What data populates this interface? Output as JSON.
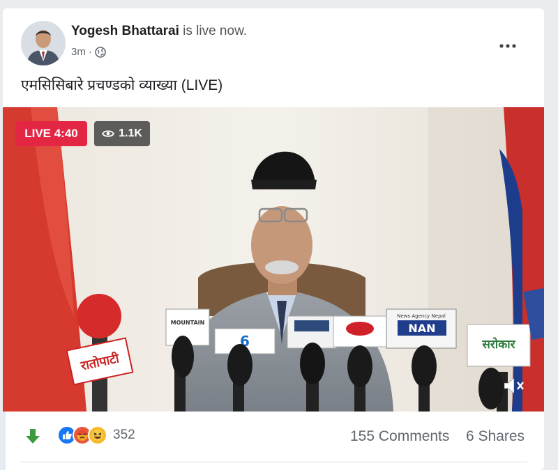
{
  "post": {
    "author": "Yogesh Bhattarai",
    "status_text": "is live now.",
    "time": "3m",
    "privacy_icon": "globe-icon",
    "text": "एमसिसिबारे प्रचण्डको व्याख्या (LIVE)"
  },
  "video": {
    "live_label": "LIVE 4:40",
    "viewers": "1.1K",
    "mic_labels": [
      "MOUNTAIN",
      "6",
      "NAN",
      "सरोकार",
      "रातोपाटी"
    ],
    "agency_text": "News Agency Nepal"
  },
  "footer": {
    "reaction_count": "352",
    "comments": "155 Comments",
    "shares": "6 Shares"
  },
  "colors": {
    "live_red": "#e42645",
    "link_blue": "#1877f2",
    "arrow_green": "#3b9a3b"
  }
}
